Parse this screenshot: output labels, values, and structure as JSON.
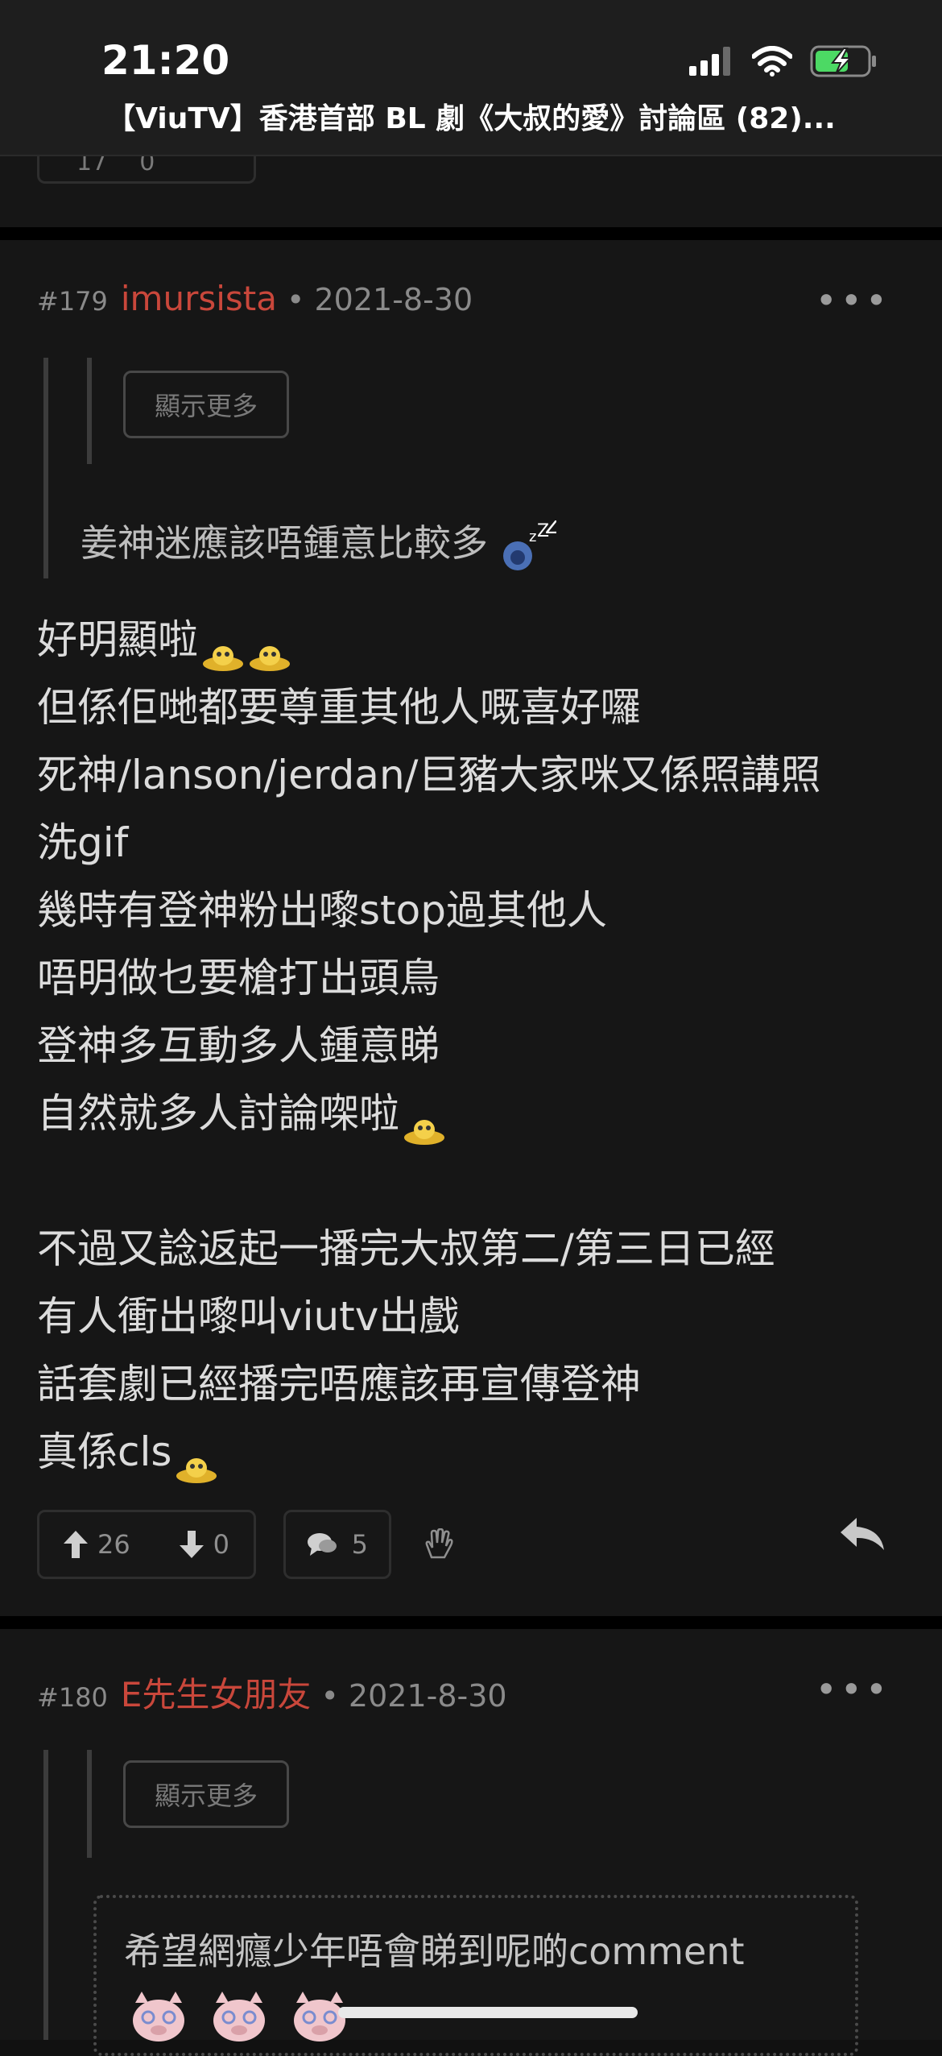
{
  "status_bar": {
    "time": "21:20"
  },
  "header": {
    "title": "【ViuTV】香港首部 BL 劇《大叔的愛》討論區 (82)..."
  },
  "previous_post": {
    "upvotes": "17",
    "downvotes": "0"
  },
  "posts": [
    {
      "floor": "#179",
      "author": "imursista",
      "date": "• 2021-8-30",
      "show_more_label": "顯示更多",
      "quote": "姜神迷應該唔鍾意比較多",
      "lines": [
        "好明顯啦",
        "但係佢哋都要尊重其他人嘅喜好囉",
        "死神/lanson/jerdan/巨豬大家咪又係照講照",
        "洗gif",
        "幾時有登神粉出嚟stop過其他人",
        "唔明做乜要槍打出頭鳥",
        "登神多互動多人鍾意睇",
        "自然就多人討論㗎啦",
        "",
        "不過又諗返起一播完大叔第二/第三日已經",
        "有人衝出嚟叫viutv出戲",
        "話套劇已經播完唔應該再宣傳登神",
        "真係cls"
      ],
      "upvotes": "26",
      "downvotes": "0",
      "comments": "5"
    },
    {
      "floor": "#180",
      "author": "E先生女朋友",
      "date": "• 2021-8-30",
      "show_more_label": "顯示更多",
      "quote": "希望網癮少年唔會睇到呢啲comment"
    }
  ],
  "colors": {
    "author": "#c9473b",
    "background": "#111111",
    "card": "#161616"
  }
}
